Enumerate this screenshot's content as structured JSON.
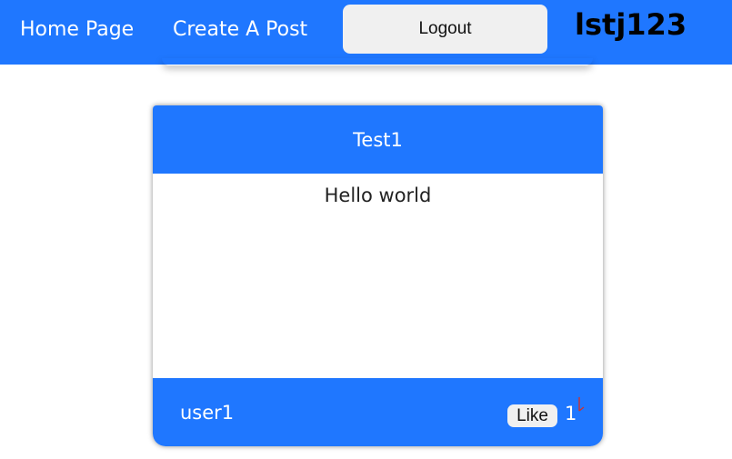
{
  "navbar": {
    "home_label": "Home Page",
    "create_label": "Create A Post",
    "logout_label": "Logout",
    "username": "lstj123"
  },
  "post": {
    "title": "Test1",
    "body": "Hello world",
    "author": "user1",
    "like_label": "Like",
    "like_count": "1"
  },
  "colors": {
    "accent": "#1f77ff",
    "button_bg": "#f0f0f0",
    "cursor_mark": "#d0312d"
  }
}
